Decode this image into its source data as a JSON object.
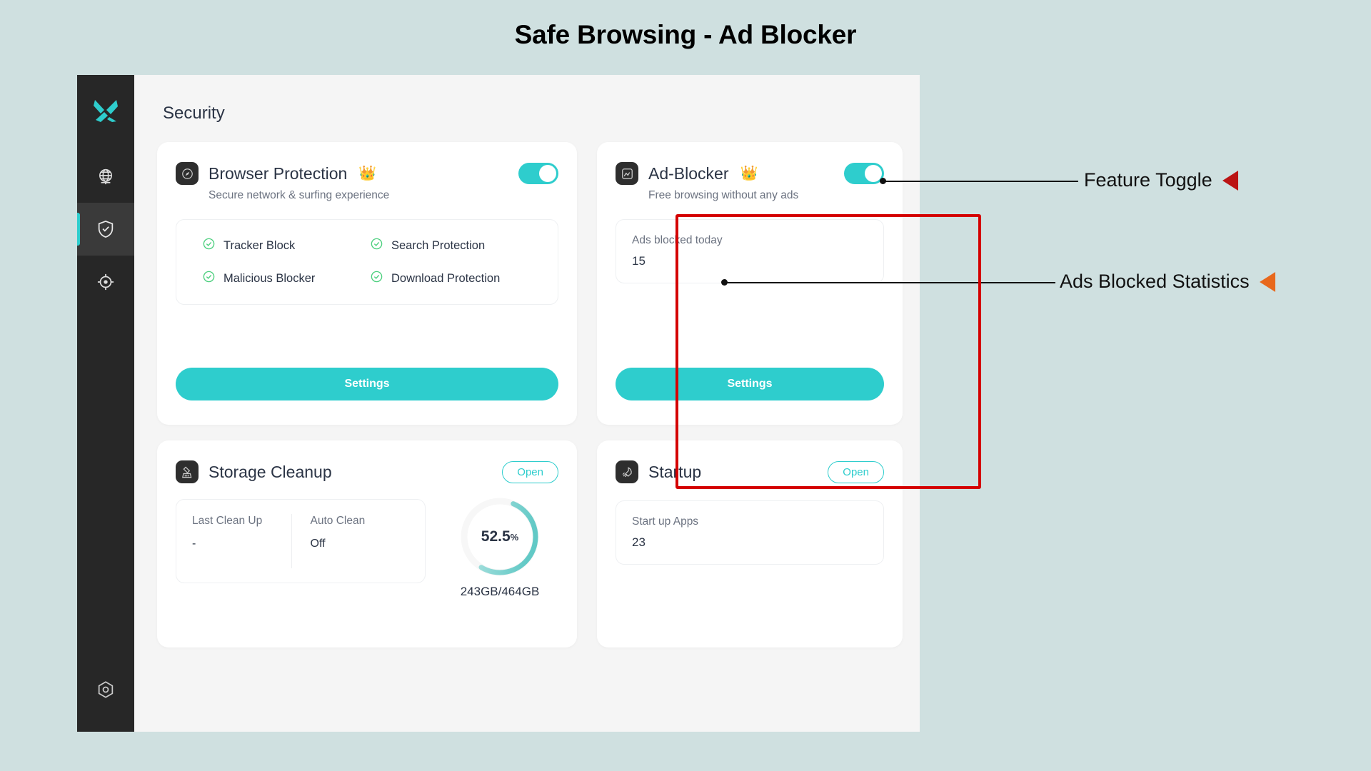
{
  "page": {
    "title": "Safe Browsing - Ad Blocker",
    "background_color": "#cfe0e0"
  },
  "theme": {
    "accent": "#2ecdcd",
    "sidebar_bg": "#272727",
    "panel_bg": "#f5f5f5",
    "card_bg": "#ffffff",
    "highlight_border": "#d40000",
    "text_primary": "#2b3445",
    "text_muted": "#6b7280",
    "check_green": "#4ccf7e"
  },
  "sidebar": {
    "logo": "x-logo-icon",
    "items": [
      {
        "name": "globe-icon",
        "label": "Web Protection",
        "active": false
      },
      {
        "name": "shield-check-icon",
        "label": "Security",
        "active": true
      },
      {
        "name": "target-icon",
        "label": "Performance",
        "active": false
      }
    ],
    "bottom": {
      "name": "hex-gear-icon",
      "label": "Settings"
    }
  },
  "main": {
    "section_title": "Security",
    "cards": [
      {
        "id": "browser-protection",
        "icon": "compass-shield-icon",
        "title": "Browser Protection",
        "badge": "👑",
        "subtitle": "Secure network & surfing experience",
        "toggle_on": true,
        "features": [
          "Tracker Block",
          "Search Protection",
          "Malicious Blocker",
          "Download Protection"
        ],
        "button_label": "Settings"
      },
      {
        "id": "ad-blocker",
        "icon": "ad-block-icon",
        "title": "Ad-Blocker",
        "badge": "👑",
        "subtitle": "Free browsing without any ads",
        "toggle_on": true,
        "stat_label": "Ads blocked today",
        "stat_value": "15",
        "button_label": "Settings",
        "highlighted": true
      },
      {
        "id": "storage-cleanup",
        "icon": "brush-icon",
        "title": "Storage Cleanup",
        "action_label": "Open",
        "fields": [
          {
            "label": "Last Clean Up",
            "value": "-"
          },
          {
            "label": "Auto Clean",
            "value": "Off"
          }
        ],
        "donut": {
          "percent_text": "52.5",
          "percent_unit": "%",
          "percent_value": 52.5,
          "total_text": "243GB/464GB"
        }
      },
      {
        "id": "startup",
        "icon": "rocket-icon",
        "title": "Startup",
        "action_label": "Open",
        "stat_label": "Start up Apps",
        "stat_value": "23"
      }
    ]
  },
  "annotations": [
    {
      "id": "feature-toggle",
      "text": "Feature Toggle",
      "marker_color": "#bb1414",
      "marker": "left-triangle"
    },
    {
      "id": "ads-blocked-statistics",
      "text": "Ads Blocked Statistics",
      "marker_color": "#e8681c",
      "marker": "left-triangle"
    }
  ]
}
